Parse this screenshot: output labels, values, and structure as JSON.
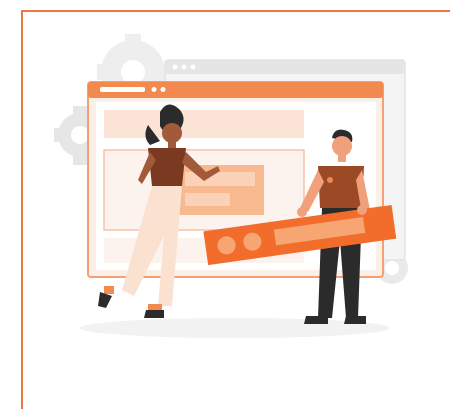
{
  "card": {
    "accent_color": "#e8783f",
    "illustration": {
      "subject": "two-people-building-webpage-layout",
      "icons": [
        "gear-icon",
        "browser-window-icon"
      ]
    }
  }
}
